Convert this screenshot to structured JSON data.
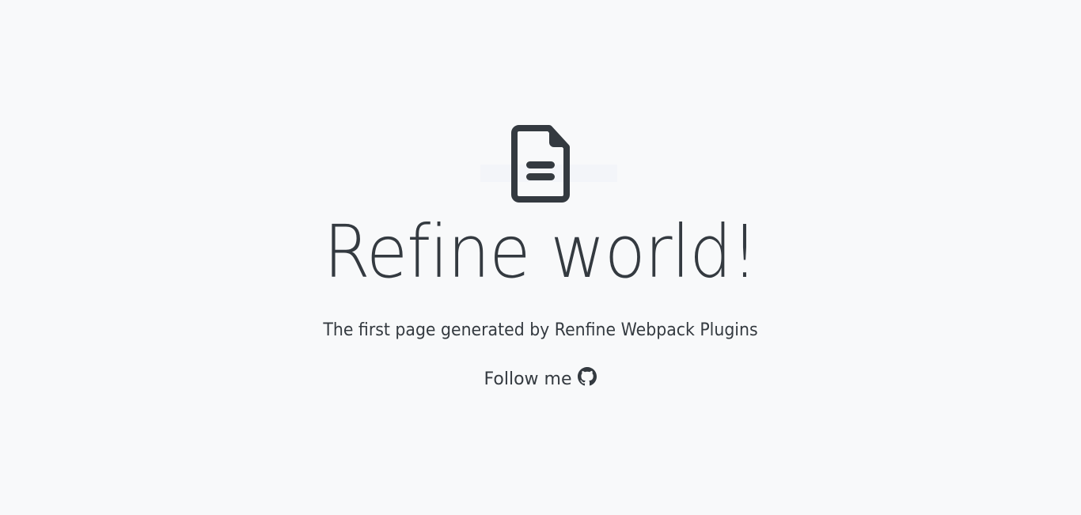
{
  "hero": {
    "icon": "file-document-icon",
    "title": "Refine world!",
    "subtitle": "The first page generated by Renfine Webpack Plugins",
    "follow_label": "Follow me",
    "follow_icon": "github-icon"
  },
  "colors": {
    "background": "#f8f9fa",
    "text": "#343a40"
  }
}
